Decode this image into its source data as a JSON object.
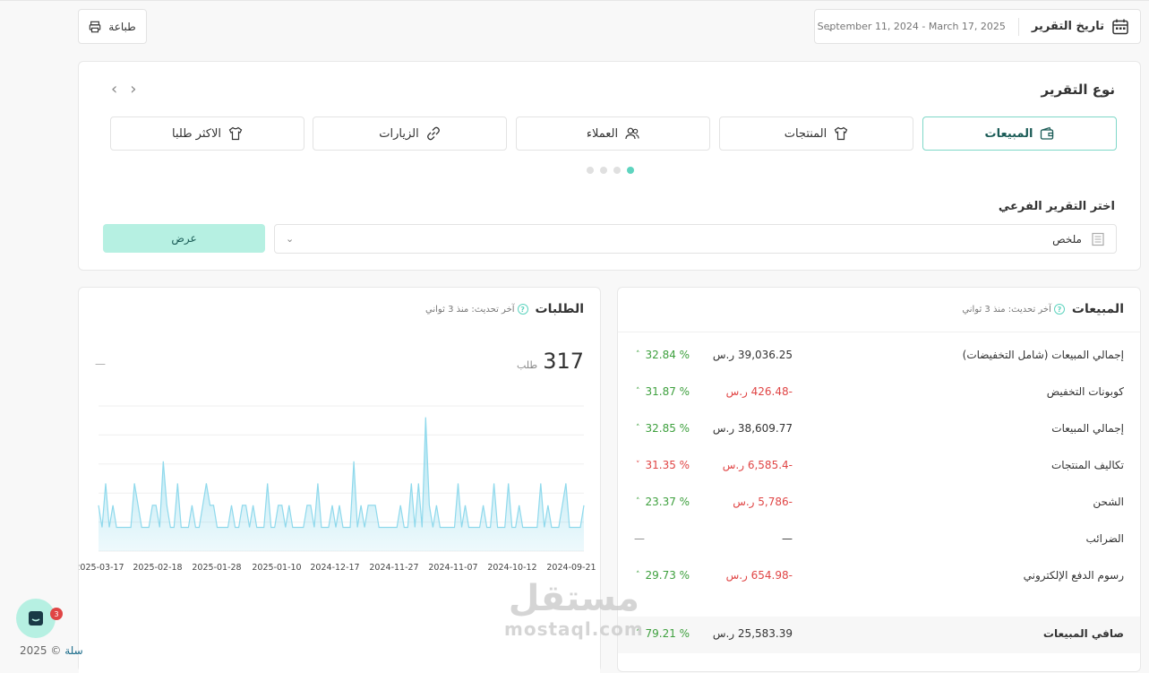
{
  "toolbar": {
    "print_label": "طباعة"
  },
  "date_filter": {
    "label": "تاريخ التقرير",
    "range": "September 11, 2024 - March 17, 2025"
  },
  "report_type": {
    "title": "نوع التقرير",
    "tabs": [
      {
        "label": "المبيعات",
        "icon": "wallet-icon",
        "active": true
      },
      {
        "label": "المنتجات",
        "icon": "shirt-icon",
        "active": false
      },
      {
        "label": "العملاء",
        "icon": "users-icon",
        "active": false
      },
      {
        "label": "الزيارات",
        "icon": "link-icon",
        "active": false
      },
      {
        "label": "الاكثر طلبا",
        "icon": "shirt-icon",
        "active": false
      }
    ],
    "pager_dots": 4,
    "pager_active": 0,
    "sub_label": "اختر التقرير الفرعي",
    "sub_value": "ملخص",
    "show_button": "عرض"
  },
  "sales": {
    "title": "المبيعات",
    "updated": "آخر تحديث: منذ 3 ثواني",
    "rows": [
      {
        "name": "إجمالي المبيعات (شامل التخفيضات)",
        "value": "39,036.25 ر.س",
        "neg": false,
        "pct": "32.84 %",
        "trend": "up"
      },
      {
        "name": "كوبونات التخفيض",
        "value": "-426.48 ر.س",
        "neg": true,
        "pct": "31.87 %",
        "trend": "up"
      },
      {
        "name": "إجمالي المبيعات",
        "value": "38,609.77 ر.س",
        "neg": false,
        "pct": "32.85 %",
        "trend": "up"
      },
      {
        "name": "تكاليف المنتجات",
        "value": "-6,585.4 ر.س",
        "neg": true,
        "pct": "31.35 %",
        "trend": "down"
      },
      {
        "name": "الشحن",
        "value": "-5,786 ر.س",
        "neg": true,
        "pct": "23.37 %",
        "trend": "up"
      },
      {
        "name": "الضرائب",
        "value": "—",
        "neg": false,
        "pct": "—",
        "trend": "none"
      },
      {
        "name": "رسوم الدفع الإلكتروني",
        "value": "-654.98 ر.س",
        "neg": true,
        "pct": "29.73 %",
        "trend": "up"
      }
    ],
    "total": {
      "name": "صافي المبيعات",
      "value": "25,583.39 ر.س",
      "pct": "79.21 %"
    }
  },
  "orders": {
    "title": "الطلبات",
    "updated": "آخر تحديث: منذ 3 ثواني",
    "count": "317",
    "unit": "طلب",
    "dash": "—"
  },
  "chart_data": {
    "type": "area",
    "x_ticks": [
      "2025-03-17",
      "2025-02-18",
      "2025-01-28",
      "2025-01-10",
      "2024-12-17",
      "2024-11-27",
      "2024-11-07",
      "2024-10-12",
      "2024-09-21"
    ],
    "values": [
      2,
      1,
      3,
      1,
      2,
      1,
      1,
      1,
      1,
      1,
      3,
      2,
      1,
      1,
      1,
      2,
      2,
      1,
      4,
      2,
      1,
      1,
      3,
      1,
      1,
      1,
      2,
      1,
      1,
      2,
      3,
      2,
      2,
      1,
      1,
      1,
      1,
      2,
      1,
      1,
      2,
      2,
      1,
      2,
      1,
      1,
      1,
      3,
      1,
      1,
      2,
      2,
      1,
      2,
      1,
      1,
      1,
      1,
      2,
      2,
      1,
      3,
      1,
      1,
      1,
      2,
      1,
      2,
      1,
      1,
      1,
      4,
      1,
      2,
      1,
      2,
      2,
      2,
      1,
      1,
      1,
      1,
      1,
      1,
      2,
      1,
      1,
      3,
      1,
      3,
      1,
      6,
      2,
      1,
      2,
      1,
      1,
      1,
      1,
      1,
      3,
      1,
      2,
      1,
      1,
      1,
      1,
      2,
      1,
      1,
      3,
      1,
      1,
      1,
      3,
      1,
      1,
      2,
      1,
      1,
      1,
      1,
      1,
      3,
      1,
      2,
      1,
      1,
      1,
      2,
      3,
      1,
      1,
      1,
      1,
      2
    ],
    "color": "#8fd9ec"
  },
  "footer": {
    "copyright": "2025 ©",
    "brand": "سلة",
    "notif_count": "3"
  },
  "watermark": {
    "ar": "مستقل",
    "en": "mostaql.com"
  }
}
